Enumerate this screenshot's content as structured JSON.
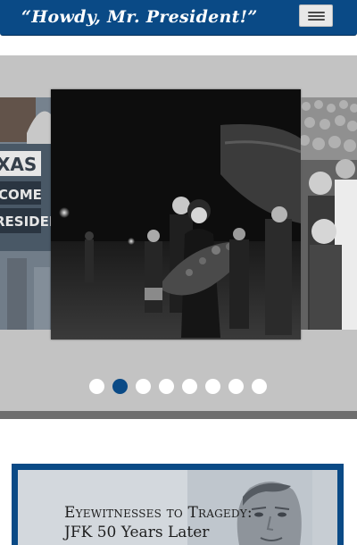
{
  "header": {
    "brand": "“Howdy, Mr. President!”",
    "menu_icon": "hamburger-menu-icon"
  },
  "carousel": {
    "dot_count": 8,
    "active_index": 1,
    "left_slide_sign_lines": [
      "XAS",
      "COME",
      "RESIDENT"
    ]
  },
  "feature": {
    "title_line_1": "Eyewitnesses to Tragedy:",
    "title_line_2": "JFK 50 Years Later"
  },
  "colors": {
    "brand_blue": "#0a4a86",
    "carousel_bg": "#c3c3c3",
    "carousel_border": "#6e6e6e"
  }
}
